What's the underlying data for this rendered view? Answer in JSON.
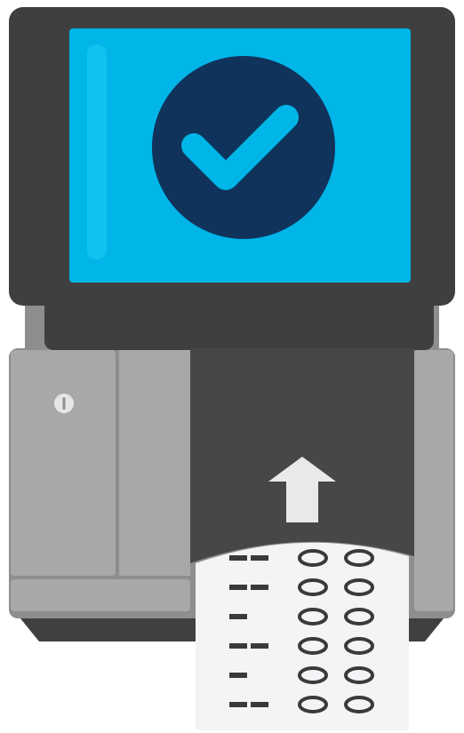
{
  "device": {
    "name": "ballot scanner",
    "screen_state": "success",
    "screen_icon": "checkmark-icon",
    "power_icon": "power-button-icon",
    "feed_icon": "up-arrow-icon",
    "ballot_rows": [
      {
        "marks": 2,
        "bubbles": 2
      },
      {
        "marks": 2,
        "bubbles": 2
      },
      {
        "marks": 1,
        "bubbles": 2
      },
      {
        "marks": 2,
        "bubbles": 2
      },
      {
        "marks": 1,
        "bubbles": 2
      },
      {
        "marks": 2,
        "bubbles": 2
      }
    ]
  },
  "colors": {
    "housing_dark": "#3f3f3f",
    "housing_mid": "#8e8e8e",
    "housing_light": "#a8a8a8",
    "base_dark": "#404040",
    "screen_blue": "#00b5e8",
    "screen_edge": "#10c2ef",
    "check_circle": "#10335b",
    "check_mark": "#00b5e8",
    "slot_dark": "#474747",
    "arrow": "#e7e9ea",
    "ballot_paper": "#f2f4f6",
    "ballot_ink": "#3a3a3a"
  }
}
